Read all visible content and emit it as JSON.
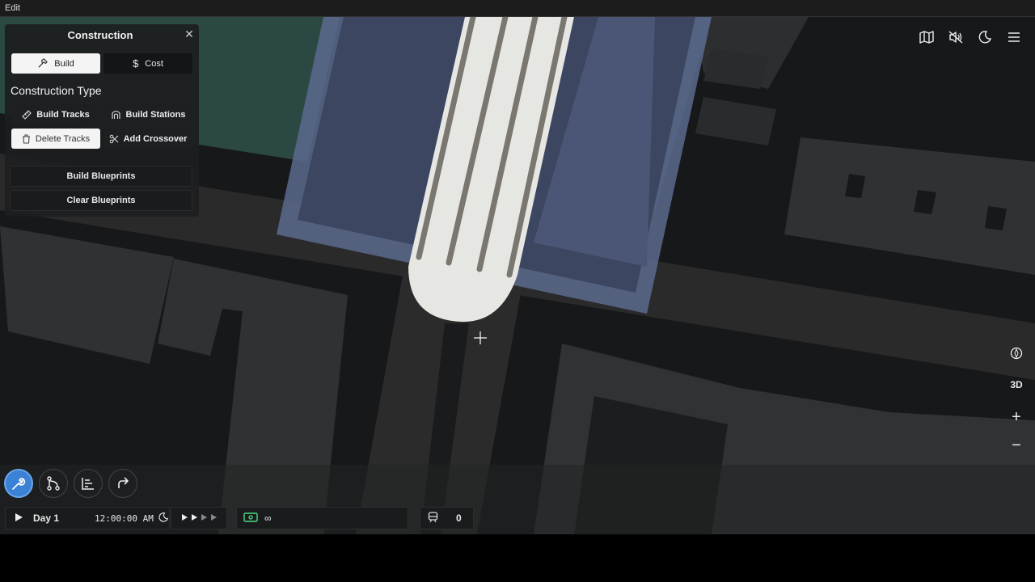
{
  "menubar": {
    "edit": "Edit"
  },
  "panel": {
    "title": "Construction",
    "tabs": [
      {
        "label": "Build",
        "icon": "hammer-icon",
        "active": true
      },
      {
        "label": "Cost",
        "icon": "dollar-icon",
        "active": false
      }
    ],
    "section_title": "Construction Type",
    "actions": [
      {
        "label": "Build Tracks",
        "icon": "ruler-icon",
        "active": false
      },
      {
        "label": "Build Stations",
        "icon": "station-icon",
        "active": false
      },
      {
        "label": "Delete Tracks",
        "icon": "trash-icon",
        "active": true
      },
      {
        "label": "Add Crossover",
        "icon": "scissors-icon",
        "active": false
      }
    ],
    "build_blueprints": "Build Blueprints",
    "clear_blueprints": "Clear Blueprints"
  },
  "top_right_icons": [
    "map-icon",
    "mute-icon",
    "moon-icon",
    "menu-icon"
  ],
  "side_controls": {
    "compass": "compass-icon",
    "view3d": "3D",
    "zoom_in": "+",
    "zoom_out": "−"
  },
  "tools": [
    "wrench-icon",
    "branch-icon",
    "chart-icon",
    "redo-icon"
  ],
  "status": {
    "day": "Day 1",
    "time": "12:00:00 AM",
    "money": "∞",
    "trains": "0"
  },
  "colors": {
    "accent": "#3b82d6",
    "money_green": "#4ade80",
    "blueprint": "#7f93c7"
  }
}
